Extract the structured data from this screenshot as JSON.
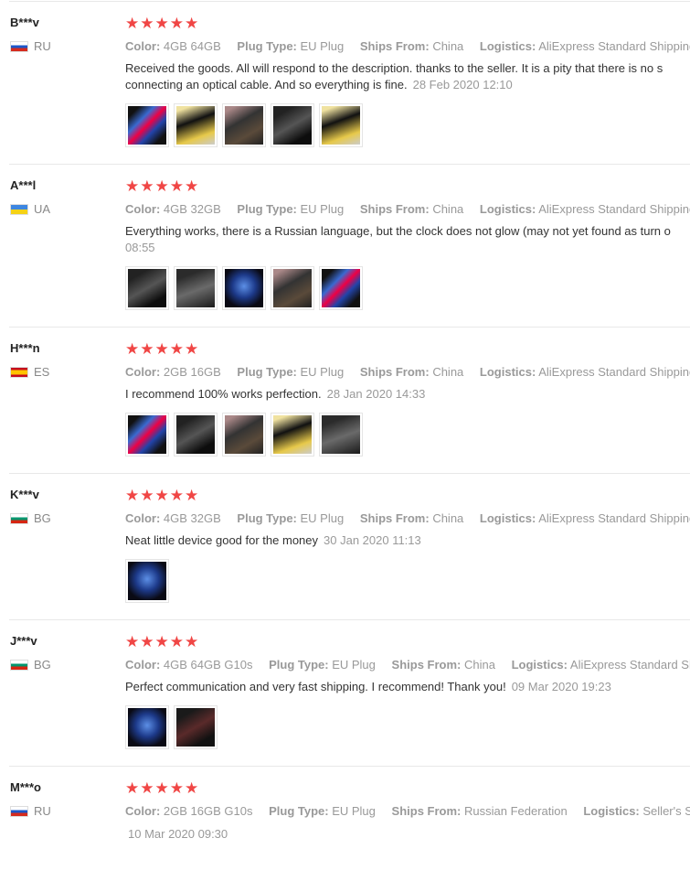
{
  "labels": {
    "color": "Color:",
    "plug": "Plug Type:",
    "ships": "Ships From:",
    "logistics": "Logistics:"
  },
  "stars": "★★★★★",
  "reviews": [
    {
      "user": "B***v",
      "country": "RU",
      "color": "4GB 64GB",
      "plug": "EU Plug",
      "ships": "China",
      "logistics": "AliExpress Standard Shipping",
      "text_line1": "Received the goods. All will respond to the description. thanks to the seller. It is a pity that there is no s",
      "text_line2": "connecting an optical cable. And so everything is fine.",
      "date": "28 Feb 2020 12:10",
      "photo_count": 5
    },
    {
      "user": "A***l",
      "country": "UA",
      "color": "4GB 32GB",
      "plug": "EU Plug",
      "ships": "China",
      "logistics": "AliExpress Standard Shipping",
      "text_line1": "Everything works, there is a Russian language, but the clock does not glow (may not yet found as turn o",
      "date": "08:55",
      "photo_count": 5
    },
    {
      "user": "H***n",
      "country": "ES",
      "color": "2GB 16GB",
      "plug": "EU Plug",
      "ships": "China",
      "logistics": "AliExpress Standard Shipping",
      "text_line1": "I recommend 100% works perfection.",
      "date": "28 Jan 2020 14:33",
      "photo_count": 5
    },
    {
      "user": "K***v",
      "country": "BG",
      "color": "4GB 32GB",
      "plug": "EU Plug",
      "ships": "China",
      "logistics": "AliExpress Standard Shipping",
      "text_line1": "Neat little device good for the money",
      "date": "30 Jan 2020 11:13",
      "photo_count": 1
    },
    {
      "user": "J***v",
      "country": "BG",
      "color": "4GB 64GB G10s",
      "plug": "EU Plug",
      "ships": "China",
      "logistics": "AliExpress Standard Shippin",
      "text_line1": "Perfect communication and very fast shipping. I recommend! Thank you!",
      "date": "09 Mar 2020 19:23",
      "photo_count": 2
    },
    {
      "user": "M***o",
      "country": "RU",
      "color": "2GB 16GB G10s",
      "plug": "EU Plug",
      "ships": "Russian Federation",
      "logistics": "Seller's Shippi",
      "date": "10 Mar 2020 09:30",
      "photo_count": 0
    }
  ]
}
